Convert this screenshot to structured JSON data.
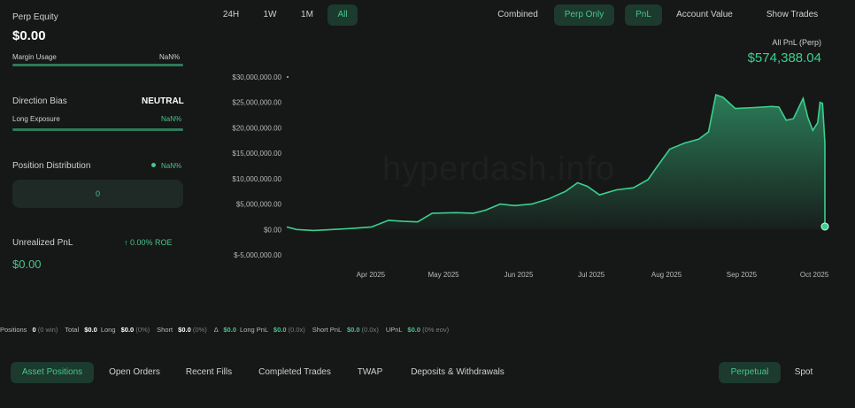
{
  "left_panel": {
    "perp_equity_label": "Perp Equity",
    "perp_equity_value": "$0.00",
    "margin_usage_label": "Margin Usage",
    "margin_usage_value": "NaN%",
    "direction_bias_label": "Direction Bias",
    "direction_bias_value": "NEUTRAL",
    "long_exposure_label": "Long Exposure",
    "long_exposure_value": "NaN%",
    "position_distribution_label": "Position Distribution",
    "position_distribution_value": "NaN%",
    "distribution_box_value": "0",
    "unrealized_pnl_label": "Unrealized PnL",
    "roe_value": "↑ 0.00% ROE",
    "unrealized_pnl_value": "$0.00"
  },
  "time_range": {
    "options": [
      "24H",
      "1W",
      "1M",
      "All"
    ],
    "selected": "All"
  },
  "view_filters": {
    "combined": "Combined",
    "perp_only": "Perp Only",
    "pnl": "PnL",
    "account_value": "Account Value",
    "show_trades": "Show Trades"
  },
  "chart_header": {
    "label": "All PnL (Perp)",
    "value": "$574,388.04"
  },
  "watermark": "hyperdash.info",
  "chart_data": {
    "type": "area",
    "x_tick_labels": [
      "Apr 2025",
      "May 2025",
      "Jun 2025",
      "Jul 2025",
      "Aug 2025",
      "Sep 2025",
      "Oct 2025"
    ],
    "y_tick_labels": [
      "$30,000,000.00",
      "$25,000,000.00",
      "$20,000,000.00",
      "$15,000,000.00",
      "$10,000,000.00",
      "$5,000,000.00",
      "$0.00",
      "$-5,000,000.00"
    ],
    "ylim": [
      -5000000,
      30000000
    ],
    "xlim": [
      "2025-03-01",
      "2025-10-09"
    ],
    "series": [
      {
        "color": "#3ccf8e",
        "points": [
          [
            "2025-03-01",
            500000
          ],
          [
            "2025-03-05",
            0
          ],
          [
            "2025-03-12",
            -200000
          ],
          [
            "2025-03-20",
            0
          ],
          [
            "2025-03-28",
            200000
          ],
          [
            "2025-04-05",
            500000
          ],
          [
            "2025-04-12",
            1800000
          ],
          [
            "2025-04-18",
            1600000
          ],
          [
            "2025-04-24",
            1500000
          ],
          [
            "2025-04-30",
            3200000
          ],
          [
            "2025-05-10",
            3300000
          ],
          [
            "2025-05-17",
            3200000
          ],
          [
            "2025-05-22",
            3800000
          ],
          [
            "2025-05-28",
            5000000
          ],
          [
            "2025-06-03",
            4700000
          ],
          [
            "2025-06-10",
            5000000
          ],
          [
            "2025-06-17",
            6000000
          ],
          [
            "2025-06-24",
            7500000
          ],
          [
            "2025-06-29",
            9200000
          ],
          [
            "2025-07-03",
            8500000
          ],
          [
            "2025-07-08",
            6800000
          ],
          [
            "2025-07-15",
            7800000
          ],
          [
            "2025-07-22",
            8200000
          ],
          [
            "2025-07-28",
            9800000
          ],
          [
            "2025-08-01",
            12500000
          ],
          [
            "2025-08-06",
            15800000
          ],
          [
            "2025-08-12",
            17000000
          ],
          [
            "2025-08-18",
            17800000
          ],
          [
            "2025-08-22",
            19200000
          ],
          [
            "2025-08-25",
            26500000
          ],
          [
            "2025-08-28",
            26000000
          ],
          [
            "2025-09-02",
            23800000
          ],
          [
            "2025-09-10",
            24000000
          ],
          [
            "2025-09-17",
            24200000
          ],
          [
            "2025-09-20",
            24100000
          ],
          [
            "2025-09-23",
            21500000
          ],
          [
            "2025-09-26",
            21800000
          ],
          [
            "2025-09-30",
            25800000
          ],
          [
            "2025-10-02",
            22000000
          ],
          [
            "2025-10-04",
            19500000
          ],
          [
            "2025-10-06",
            21000000
          ],
          [
            "2025-10-07",
            25000000
          ],
          [
            "2025-10-08",
            24800000
          ],
          [
            "2025-10-09",
            17000000
          ],
          [
            "2025-10-09",
            574388
          ]
        ]
      }
    ],
    "grid": false
  },
  "stats_bar": [
    {
      "label": "Positions",
      "value": "0",
      "extra": "(0 win)"
    },
    {
      "label": "Total",
      "value": "$0.0"
    },
    {
      "label": "Long",
      "value": "$0.0",
      "extra": "(0%)"
    },
    {
      "label": "Short",
      "value": "$0.0",
      "extra": "(0%)"
    },
    {
      "label": "Δ",
      "value": "$0.0",
      "green": true
    },
    {
      "label": "Long PnL",
      "value": "$0.0",
      "extra": "(0.0x)",
      "green": true
    },
    {
      "label": "Short PnL",
      "value": "$0.0",
      "extra": "(0.0x)",
      "green": true
    },
    {
      "label": "UPnL",
      "value": "$0.0",
      "extra": "(0% eov)",
      "green": true
    }
  ],
  "bottom_tabs": {
    "asset_positions": "Asset Positions",
    "open_orders": "Open Orders",
    "recent_fills": "Recent Fills",
    "completed_trades": "Completed Trades",
    "twap": "TWAP",
    "deposits_withdrawals": "Deposits & Withdrawals",
    "perpetual": "Perpetual",
    "spot": "Spot"
  },
  "colors": {
    "accent": "#3ccf8e",
    "background": "#161717",
    "active_chip": "#1c3a2e"
  }
}
